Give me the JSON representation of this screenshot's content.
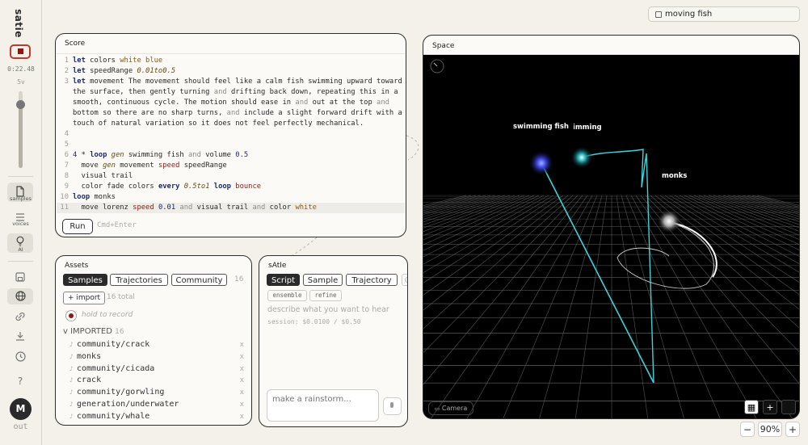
{
  "app": {
    "title": "satie",
    "avatar_initial": "M",
    "out_label": "out"
  },
  "transport": {
    "elapsed": "0:22.48",
    "volume_label": "5v",
    "volume_level": 0.85
  },
  "rail": {
    "samples_label": "samples",
    "voices_label": "voices",
    "ai_label": "AI",
    "help_label": "?"
  },
  "search": {
    "value": "moving fish"
  },
  "score": {
    "title": "Score",
    "run_label": "Run",
    "run_hint": "Cmd+Enter",
    "line_numbers": [
      "1",
      "2",
      "3",
      "",
      "",
      "",
      "",
      "4",
      "5",
      "6",
      "7",
      "8",
      "9",
      "10",
      "11"
    ]
  },
  "assets": {
    "title": "Assets",
    "tabs": [
      "Samples",
      "Trajectories",
      "Community"
    ],
    "count": "16",
    "import_label": "+ import",
    "total_label": "16 total",
    "hold_label": "hold to record",
    "imported_label": "v IMPORTED",
    "imported_count": "16",
    "items": [
      "community/crack",
      "monks",
      "community/cicada",
      "crack",
      "community/gorwling",
      "generation/underwater",
      "community/whale"
    ],
    "remove_glyph": "x"
  },
  "satie_panel": {
    "title": "sAtIe",
    "tabs": [
      "Script",
      "Sample",
      "Trajectory"
    ],
    "chips": [
      "ensemble",
      "refine"
    ],
    "describe_placeholder": "describe what you want to hear",
    "session": "session: $0.0100 / $0.50",
    "prompt_placeholder": "make a rainstorm..."
  },
  "space": {
    "title": "Space",
    "labels": [
      "swimming fish",
      "swimming fish",
      "monks"
    ],
    "camera_label": "Camera"
  },
  "zoom": {
    "value": "90%",
    "minus": "−",
    "plus": "+"
  }
}
